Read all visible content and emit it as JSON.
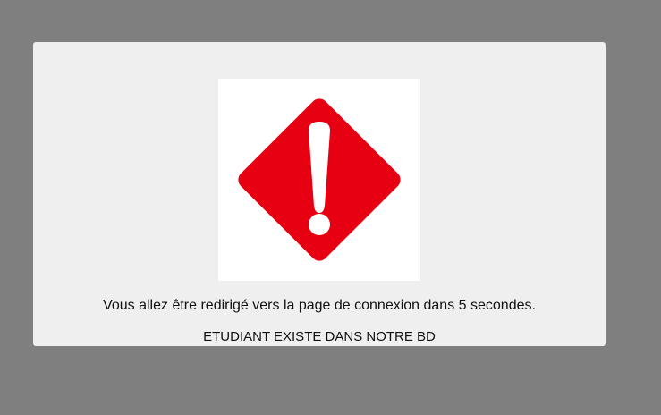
{
  "page": {
    "background_color": "#7f7f7f"
  },
  "dialog": {
    "background_color": "#efefef",
    "icon": {
      "name": "warning-diamond-icon",
      "color": "#e60012"
    },
    "redirect_message": "Vous allez être redirigé vers la page de connexion dans 5 secondes.",
    "status_message": "ETUDIANT EXISTE DANS NOTRE BD"
  }
}
